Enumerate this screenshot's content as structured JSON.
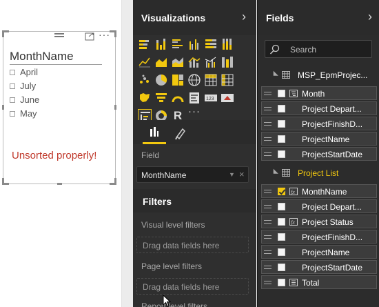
{
  "canvas": {
    "slicer": {
      "title": "MonthName",
      "items": [
        "April",
        "July",
        "June",
        "May"
      ],
      "more_label": "···"
    },
    "annotation": "Unsorted properly!",
    "annotation_color": "#c0392b"
  },
  "visualizations": {
    "title": "Visualizations",
    "chevron": "›",
    "more_label": "···",
    "r_label": "R",
    "field_label": "Field",
    "field_well_value": "MonthName",
    "field_well_remove": "×",
    "filters_title": "Filters",
    "visual_level_filters": "Visual level filters",
    "page_level_filters": "Page level filters",
    "report_level_filters": "Report level filters",
    "drop_placeholder": "Drag data fields here",
    "accent_color": "#f2c80f"
  },
  "fields": {
    "title": "Fields",
    "chevron": "›",
    "search_placeholder": "Search",
    "tables": [
      {
        "name": "MSP_EpmProjec...",
        "highlight": false,
        "fields": [
          {
            "name": "Month",
            "checked": false,
            "icon": "hierarchy"
          },
          {
            "name": "Project Depart...",
            "checked": false,
            "icon": "none"
          },
          {
            "name": "ProjectFinishD...",
            "checked": false,
            "icon": "none"
          },
          {
            "name": "ProjectName",
            "checked": false,
            "icon": "none"
          },
          {
            "name": "ProjectStartDate",
            "checked": false,
            "icon": "none"
          }
        ]
      },
      {
        "name": "Project List",
        "highlight": true,
        "fields": [
          {
            "name": "MonthName",
            "checked": true,
            "icon": "calculated"
          },
          {
            "name": "Project Depart...",
            "checked": false,
            "icon": "none"
          },
          {
            "name": "Project Status",
            "checked": false,
            "icon": "calculated"
          },
          {
            "name": "ProjectFinishD...",
            "checked": false,
            "icon": "none"
          },
          {
            "name": "ProjectName",
            "checked": false,
            "icon": "none"
          },
          {
            "name": "ProjectStartDate",
            "checked": false,
            "icon": "none"
          },
          {
            "name": "Total",
            "checked": false,
            "icon": "sigma"
          }
        ]
      }
    ]
  }
}
